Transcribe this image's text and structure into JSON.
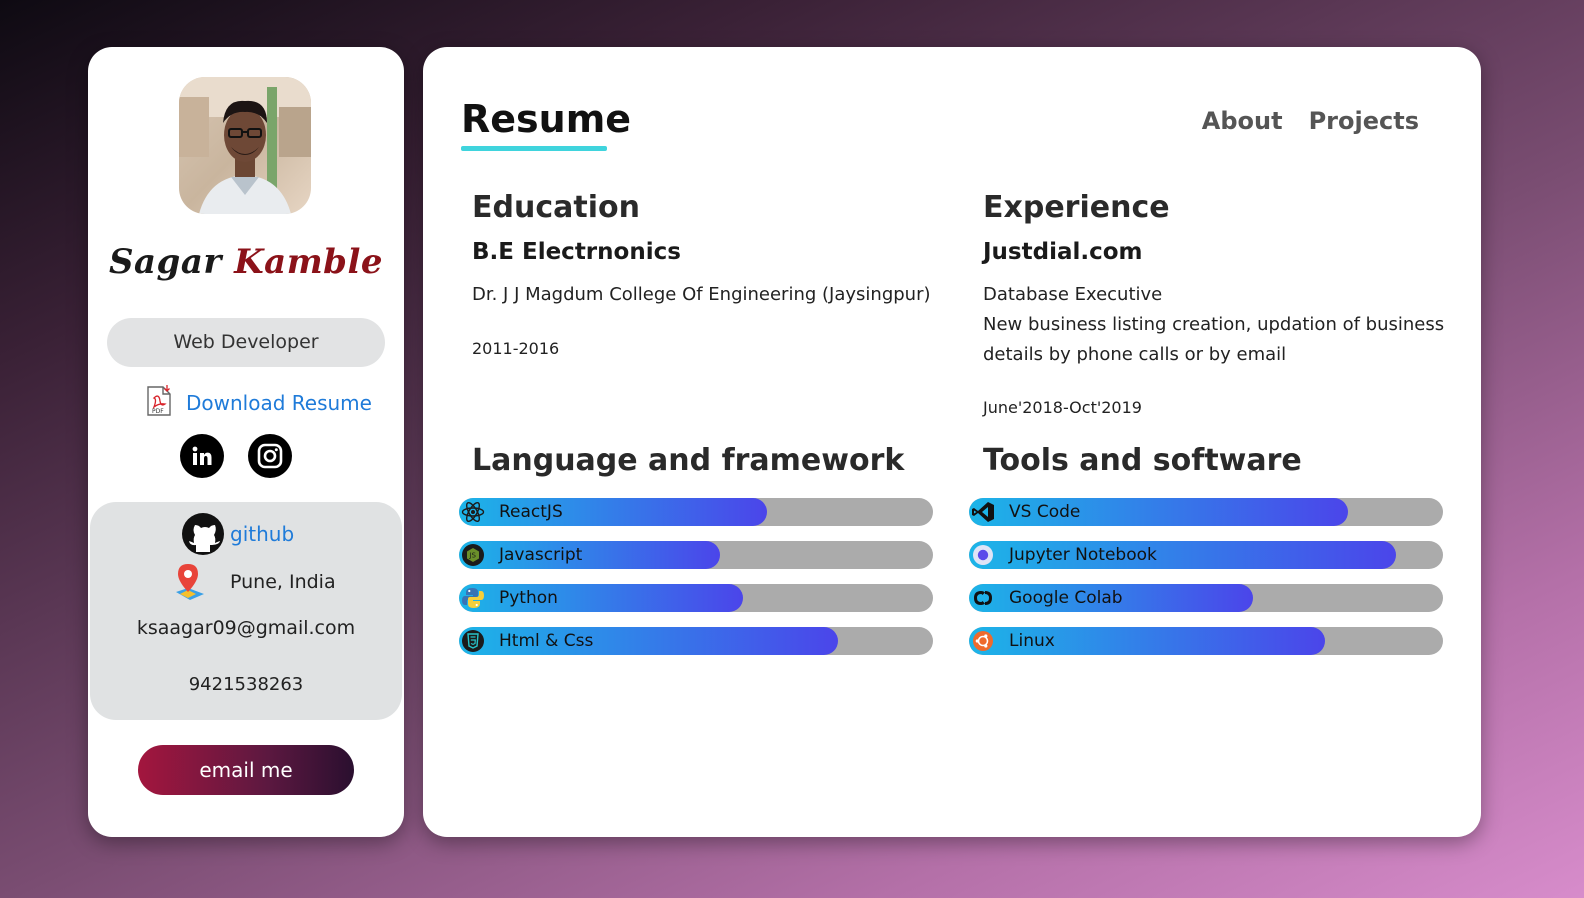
{
  "profile": {
    "first_name": "Sagar",
    "last_name": "Kamble",
    "role": "Web Developer",
    "download_label": "Download Resume",
    "github_label": "github",
    "location": "Pune, India",
    "email": "ksaagar09@gmail.com",
    "phone": "9421538263",
    "email_button": "email me",
    "pdf_badge": "PDF"
  },
  "nav": {
    "title": "Resume",
    "links": [
      "About",
      "Projects"
    ]
  },
  "education": {
    "heading": "Education",
    "degree": "B.E Electrnonics",
    "college": "Dr. J J Magdum College Of Engineering (Jaysingpur)",
    "years": "2011-2016"
  },
  "experience": {
    "heading": "Experience",
    "company": "Justdial.com",
    "position": "Database Executive",
    "description": "New business listing creation, updation of business details by phone calls or by email",
    "period": "June'2018-Oct'2019"
  },
  "skills": {
    "languages": {
      "heading": "Language and framework",
      "items": [
        {
          "label": "ReactJS",
          "level": 0.65,
          "icon": "react-icon"
        },
        {
          "label": "Javascript",
          "level": 0.55,
          "icon": "javascript-icon"
        },
        {
          "label": "Python",
          "level": 0.6,
          "icon": "python-icon"
        },
        {
          "label": "Html & Css",
          "level": 0.8,
          "icon": "html-icon"
        }
      ]
    },
    "tools": {
      "heading": "Tools and software",
      "items": [
        {
          "label": "VS Code",
          "level": 0.8,
          "icon": "vscode-icon"
        },
        {
          "label": "Jupyter Notebook",
          "level": 0.9,
          "icon": "jupyter-icon"
        },
        {
          "label": "Google Colab",
          "level": 0.6,
          "icon": "colab-icon"
        },
        {
          "label": "Linux",
          "level": 0.75,
          "icon": "linux-icon"
        }
      ]
    }
  },
  "colors": {
    "accent_underline": "#3fd4dd",
    "link": "#1f7bd9",
    "name_last": "#8b1219",
    "bar_start": "#1cb5e8",
    "bar_end": "#4b45ea",
    "bar_track": "#ababab"
  }
}
